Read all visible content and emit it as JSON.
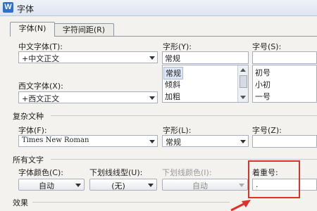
{
  "window": {
    "title": "字体",
    "app_icon": "W"
  },
  "tabs": [
    {
      "label": "字体(N)",
      "active": true
    },
    {
      "label": "字符间距(R)",
      "active": false
    }
  ],
  "chinese_font": {
    "label": "中文字体(T):",
    "value": "+中文正文"
  },
  "font_style": {
    "label": "字形(Y):",
    "value": "常规",
    "options": [
      "常规",
      "倾斜",
      "加粗"
    ],
    "selected": "常规"
  },
  "font_size": {
    "label": "字号(S):",
    "value": "",
    "options": [
      "初号",
      "小初",
      "一号"
    ]
  },
  "western_font": {
    "label": "西文字体(X):",
    "value": "+西文正文"
  },
  "complex": {
    "section": "复杂文种",
    "font_label": "字体(F):",
    "font_value": "Times New Roman",
    "style_label": "字形(L):",
    "style_value": "常规",
    "size_label": "字号(Z):",
    "size_value": ""
  },
  "all_text": {
    "section": "所有文字",
    "color_label": "字体颜色(C):",
    "color_value": "自动",
    "underline_label": "下划线线型(U):",
    "underline_value": "(无)",
    "underline_color_label": "下划线颜色(I):",
    "underline_color_value": "自动",
    "emphasis_label": "着重号:",
    "emphasis_value": "."
  },
  "effects": {
    "section": "效果"
  },
  "colors": {
    "highlight": "#e0302a",
    "accent": "#2e6fd0"
  }
}
